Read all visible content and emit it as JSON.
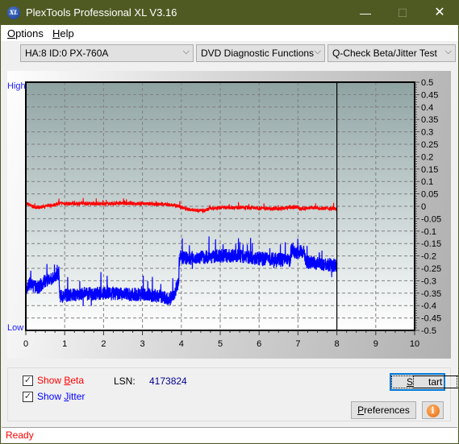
{
  "window": {
    "title": "PlexTools Professional XL V3.16",
    "app_icon_text": "XL",
    "minimize": "—",
    "maximize": "☐",
    "close": "✕"
  },
  "menu": [
    {
      "label": "Options",
      "accel": "O",
      "rest": "ptions"
    },
    {
      "label": "Help",
      "accel": "H",
      "rest": "elp"
    }
  ],
  "toolbar": {
    "drive": "HA:8 ID:0  PX-760A",
    "function": "DVD Diagnostic Functions",
    "test": "Q-Check Beta/Jitter Test",
    "dropdown_arrow": "⌵"
  },
  "chart_labels": {
    "high": "High",
    "low": "Low"
  },
  "chart_data": {
    "type": "line",
    "title": "",
    "xlabel": "",
    "ylabel": "",
    "xlim": [
      0,
      10
    ],
    "ylim": [
      -0.5,
      0.5
    ],
    "x_ticks": [
      "0",
      "1",
      "2",
      "3",
      "4",
      "5",
      "6",
      "7",
      "8",
      "9",
      "10"
    ],
    "y_ticks": [
      "0.5",
      "0.45",
      "0.4",
      "0.35",
      "0.3",
      "0.25",
      "0.2",
      "0.15",
      "0.1",
      "0.05",
      "0",
      "-0.05",
      "-0.1",
      "-0.15",
      "-0.2",
      "-0.25",
      "-0.3",
      "-0.35",
      "-0.4",
      "-0.45",
      "-0.5"
    ],
    "grid": true,
    "end_marker_x": 8.0,
    "colors": {
      "beta": "#ff0000",
      "jitter": "#0000ff",
      "grid": "#808080"
    },
    "series": [
      {
        "name": "Beta",
        "color": "#ff0000",
        "x": [
          0,
          0.05,
          0.15,
          0.3,
          0.5,
          0.7,
          0.9,
          1.2,
          1.5,
          2.0,
          2.5,
          3.0,
          3.5,
          3.8,
          3.95,
          4.1,
          4.3,
          4.6,
          4.75,
          5.0,
          5.5,
          6.0,
          6.5,
          7.0,
          7.05,
          7.3,
          7.6,
          8.0
        ],
        "y": [
          0.005,
          0.01,
          0.0,
          -0.005,
          0.0,
          0.005,
          0.012,
          0.01,
          0.012,
          0.01,
          0.012,
          0.01,
          0.008,
          0.005,
          0.0,
          -0.01,
          -0.015,
          -0.018,
          -0.008,
          -0.005,
          -0.005,
          -0.007,
          -0.01,
          -0.002,
          -0.012,
          -0.006,
          -0.008,
          -0.01
        ]
      },
      {
        "name": "Jitter",
        "color": "#0000ff",
        "x": [
          0,
          0.1,
          0.3,
          0.5,
          0.7,
          0.85,
          0.88,
          1.0,
          1.5,
          2.0,
          2.5,
          3.0,
          3.3,
          3.5,
          3.7,
          3.85,
          3.93,
          3.96,
          4.1,
          4.5,
          5.0,
          5.5,
          6.0,
          6.5,
          6.8,
          6.82,
          7.0,
          7.15,
          7.2,
          7.5,
          7.8,
          8.0
        ],
        "y": [
          -0.33,
          -0.31,
          -0.33,
          -0.3,
          -0.29,
          -0.27,
          -0.365,
          -0.36,
          -0.355,
          -0.35,
          -0.355,
          -0.355,
          -0.36,
          -0.365,
          -0.375,
          -0.34,
          -0.3,
          -0.2,
          -0.21,
          -0.205,
          -0.2,
          -0.2,
          -0.21,
          -0.215,
          -0.22,
          -0.18,
          -0.185,
          -0.18,
          -0.225,
          -0.23,
          -0.235,
          -0.24
        ]
      }
    ]
  },
  "controls": {
    "show_beta": {
      "label_pre": "Show ",
      "accel": "B",
      "label_post": "eta",
      "checked": true,
      "color": "#ff0000"
    },
    "show_jitter": {
      "label_pre": "Show ",
      "accel": "J",
      "label_post": "itter",
      "checked": true,
      "color": "#0000ff"
    },
    "lsn_label": "LSN:",
    "lsn_value": "4173824",
    "start": {
      "accel": "S",
      "rest": "tart"
    },
    "preferences": {
      "accel": "P",
      "rest": "references"
    },
    "info_icon": "i",
    "check_mark": "✓"
  },
  "status": {
    "text": "Ready"
  }
}
